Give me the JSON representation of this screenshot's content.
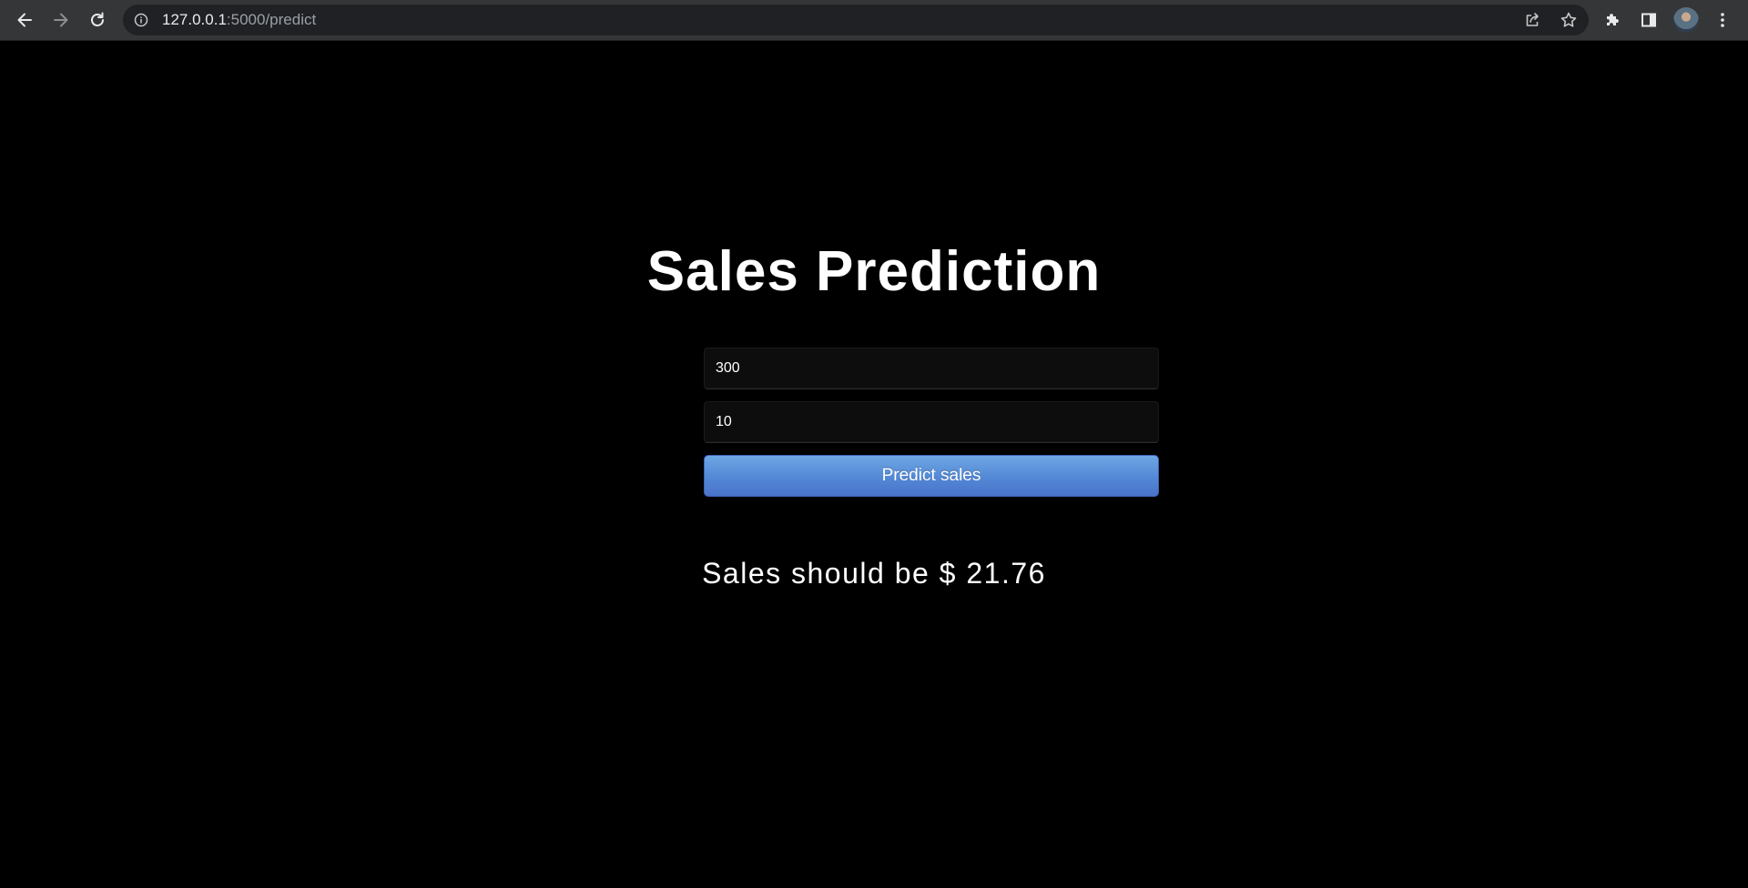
{
  "browser": {
    "url_host": "127.0.0.1",
    "url_rest": ":5000/predict"
  },
  "page": {
    "title": "Sales Prediction",
    "input1_value": "300",
    "input2_value": "10",
    "button_label": "Predict sales",
    "result_text": "Sales should be $ 21.76"
  },
  "colors": {
    "page_background": "#000000",
    "button_gradient_top": "#6ea7e4",
    "button_gradient_bottom": "#4a73c9",
    "text": "#ffffff"
  },
  "icons": {
    "back": "back-arrow-icon",
    "forward": "forward-arrow-icon",
    "reload": "reload-icon",
    "site_info": "info-icon",
    "share": "share-icon",
    "bookmark": "star-icon",
    "extensions": "puzzle-icon",
    "side_panel": "side-panel-icon",
    "menu": "kebab-menu-icon"
  }
}
